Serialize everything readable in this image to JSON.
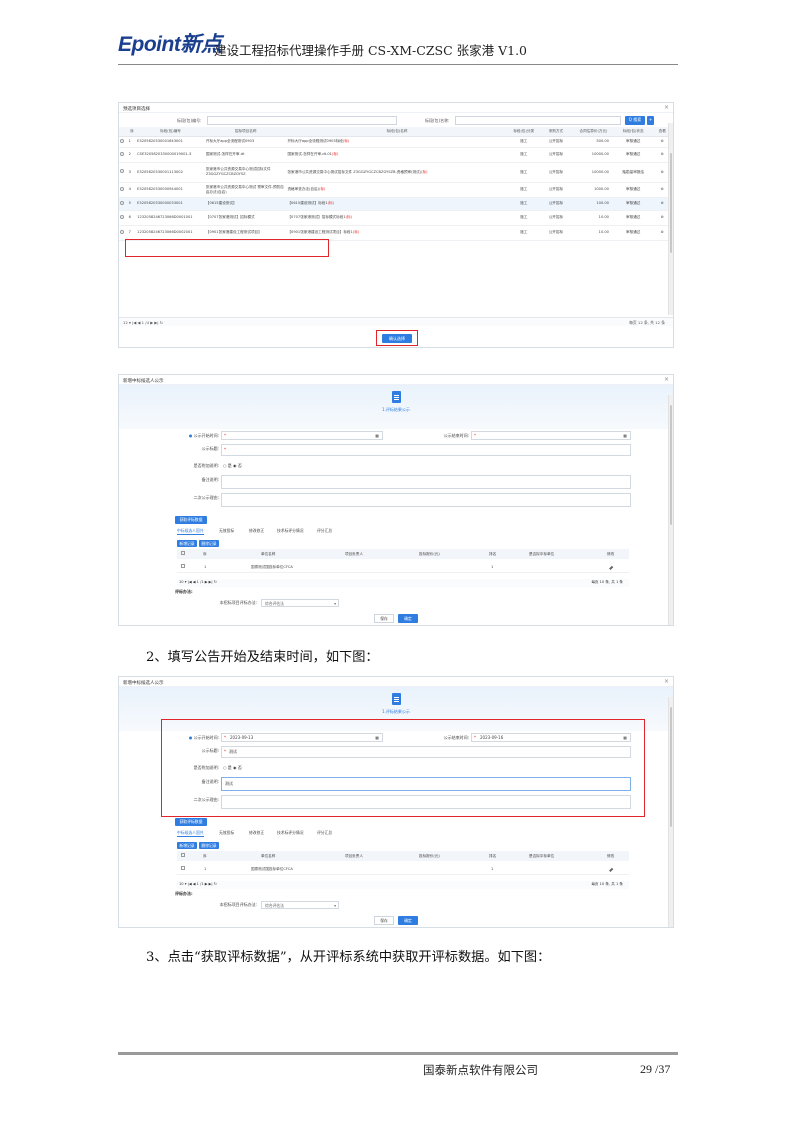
{
  "header": {
    "logo": "Epoint新点",
    "doc_title": "建设工程招标代理操作手册 CS-XM-CZSC 张家港 V1.0"
  },
  "shot1": {
    "title": "预选项目选择",
    "search": {
      "code_label": "标段(包)编号:",
      "name_label": "标段(包)名称:",
      "search_btn": "Q 搜索"
    },
    "columns": [
      "序",
      "标段(包)编号",
      "招标项目名称",
      "标段(包)名称",
      "标段(包)分类",
      "采购方式",
      "合同估算价(万元)",
      "标段(包)状态",
      "查看"
    ],
    "rows": [
      {
        "no": "1",
        "code": "E3205820330001643001",
        "project": "开标大厅app全流程测试0903",
        "name": "开标大厅app全流程测试0903标段",
        "tag": "(标)",
        "cat": "施工",
        "way": "公开招标",
        "price": "500.00",
        "status": "审核通过"
      },
      {
        "no": "2",
        "code": "CSE3205820330000019001-3",
        "project": "国家测试-怎样在开审-dt",
        "name": "国家测试-怎样在开审-dt-01",
        "tag": "(标)",
        "cat": "施工",
        "way": "公开招标",
        "price": "10000.00",
        "status": "审核通过"
      },
      {
        "no": "3",
        "code": "E3205820330001113002",
        "project": "张家港市公共资源交易中心测试招标文件 Z3GGZYGCZCBZGYSZ",
        "name": "张家港市公共资源交易中心测试招标文件 Z3GGZYGCZCBZGYSZB-资格预审(测试)",
        "tag": "(标)",
        "cat": "施工",
        "way": "公开招标",
        "price": "10000.00",
        "status": "踏勘量审报结"
      },
      {
        "no": "4",
        "code": "E3205820330000944001",
        "project": "张家港市公共资源交易中心测试 预审文件-预防自启办法(自启)",
        "name": "资格审查办法(自启)",
        "tag": "(标)",
        "cat": "施工",
        "way": "公开招标",
        "price": "1000.00",
        "status": "审核通过"
      },
      {
        "no": "5",
        "code": "E3205820330000033001",
        "project": "【0615建设测试】",
        "name": "【0615建设测试】标段1",
        "tag": "(标)",
        "cat": "施工",
        "way": "公开招标",
        "price": "100.00",
        "status": "审核通过"
      },
      {
        "no": "6",
        "code": "1232058246723066D0001001",
        "project": "【0707张家港测试】招标模式",
        "name": "【0707张家港测试】招标模式标段1",
        "tag": "(标)",
        "cat": "施工",
        "way": "公开招标",
        "price": "10.00",
        "status": "审核通过"
      },
      {
        "no": "7",
        "code": "1232058246723066D0002001",
        "project": "【0901张家港建设工程测试项目】",
        "name": "【0901张家港建设工程测试项目】标段1",
        "tag": "(标)",
        "cat": "施工",
        "way": "公开招标",
        "price": "10.00",
        "status": "审核通过"
      }
    ],
    "pager_left": "12 ▾  |◀  ◀  1 /4  ▶  ▶|  ↻",
    "pager_right": "每页 12 条, 共 12 条",
    "confirm_btn": "确认选择"
  },
  "shot2": {
    "title": "新增中标候选人公示",
    "step": "1.评标结果公示",
    "fields": {
      "start_label": "公示开始时间:",
      "end_label": "公示结束时间:",
      "title_label": "公示标题:",
      "attach_label": "是否附加说明:",
      "yes": "是",
      "no": "否",
      "remark_label": "备注说明:",
      "second_label": "二次公示理由:",
      "start_value": "",
      "end_value": "",
      "title_value": "",
      "remark_value": ""
    },
    "fetch_btn": "获取评标数据",
    "tabs": [
      "中标候选人国共",
      "无效投标",
      "修改修正",
      "技术标评分情况",
      "评分汇总"
    ],
    "grid_btns": [
      "新增记录",
      "删除记录"
    ],
    "grid_cols": [
      "序",
      "单位名称",
      "项目负责人",
      "投标报价(元)",
      "排名",
      "是否拟中标单位",
      "修改"
    ],
    "grid_row": {
      "no": "1",
      "unit": "国泰测试国投标单位CFCA",
      "rank": "1"
    },
    "pager_left": "10 ▾  |◀  ◀  1 /1  ▶  ▶|  ↻",
    "pager_right": "每页 10 条, 共 1 条",
    "method_label": "评标办法:",
    "method_field_label": "本招标项目评标办法:",
    "method_value": "综合评估法",
    "save_btn": "保存",
    "ok_btn": "确定"
  },
  "para2": "2、填写公告开始及结束时间，如下图：",
  "shot3": {
    "title": "新增中标候选人公示",
    "step": "1.评标结果公示",
    "fields": {
      "start_value": "2023-09-13",
      "end_value": "2023-09-16",
      "title_value": "测试",
      "remark_value": "测试"
    }
  },
  "para3": "3、点击“获取评标数据”，从开评标系统中获取开评标数据。如下图：",
  "footer": {
    "company": "国泰新点软件有限公司",
    "page": "29 /37"
  },
  "colors": {
    "accent": "#2f7de1",
    "highlight": "#e0262b",
    "logo": "#1b3f8f"
  }
}
